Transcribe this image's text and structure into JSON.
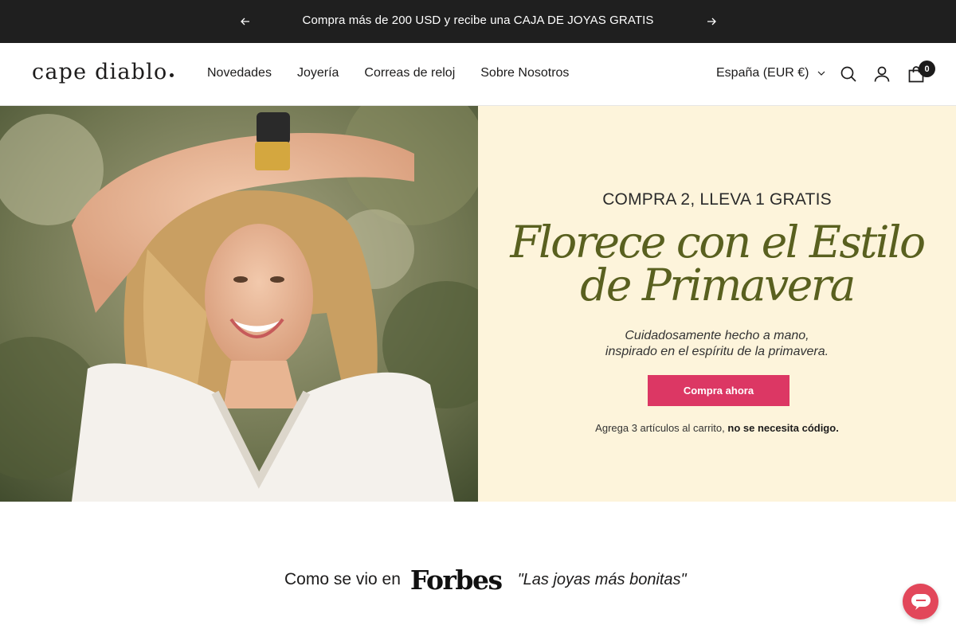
{
  "announcement": {
    "text": "Compra más de 200 USD y recibe una CAJA DE JOYAS GRATIS",
    "prev_icon": "arrow-left-icon",
    "next_icon": "arrow-right-icon"
  },
  "header": {
    "logo": "cape diablo",
    "nav": [
      {
        "label": "Novedades"
      },
      {
        "label": "Joyería"
      },
      {
        "label": "Correas de reloj"
      },
      {
        "label": "Sobre Nosotros"
      }
    ],
    "locale": "España (EUR €)",
    "cart_count": "0",
    "icons": [
      "search-icon",
      "account-icon",
      "cart-icon"
    ]
  },
  "hero": {
    "eyebrow": "COMPRA 2, LLEVA 1 GRATIS",
    "headline_line1": "Florece con el Estilo",
    "headline_line2": "de Primavera",
    "sub_line1": "Cuidadosamente hecho a mano,",
    "sub_line2": "inspirado en el espíritu de la primavera.",
    "cta_label": "Compra ahora",
    "note_prefix": "Agrega 3 artículos al carrito,",
    "note_bold": "no se necesita código."
  },
  "press": {
    "as_seen": "Como se vio en",
    "publication": "Forbes",
    "quote": "\"Las joyas más bonitas\""
  },
  "colors": {
    "announcement_bg": "#1f1f1f",
    "hero_panel_bg": "#fdf4db",
    "headline": "#59601f",
    "cta_bg": "#dc3764",
    "chat_bg": "#e2475a"
  }
}
